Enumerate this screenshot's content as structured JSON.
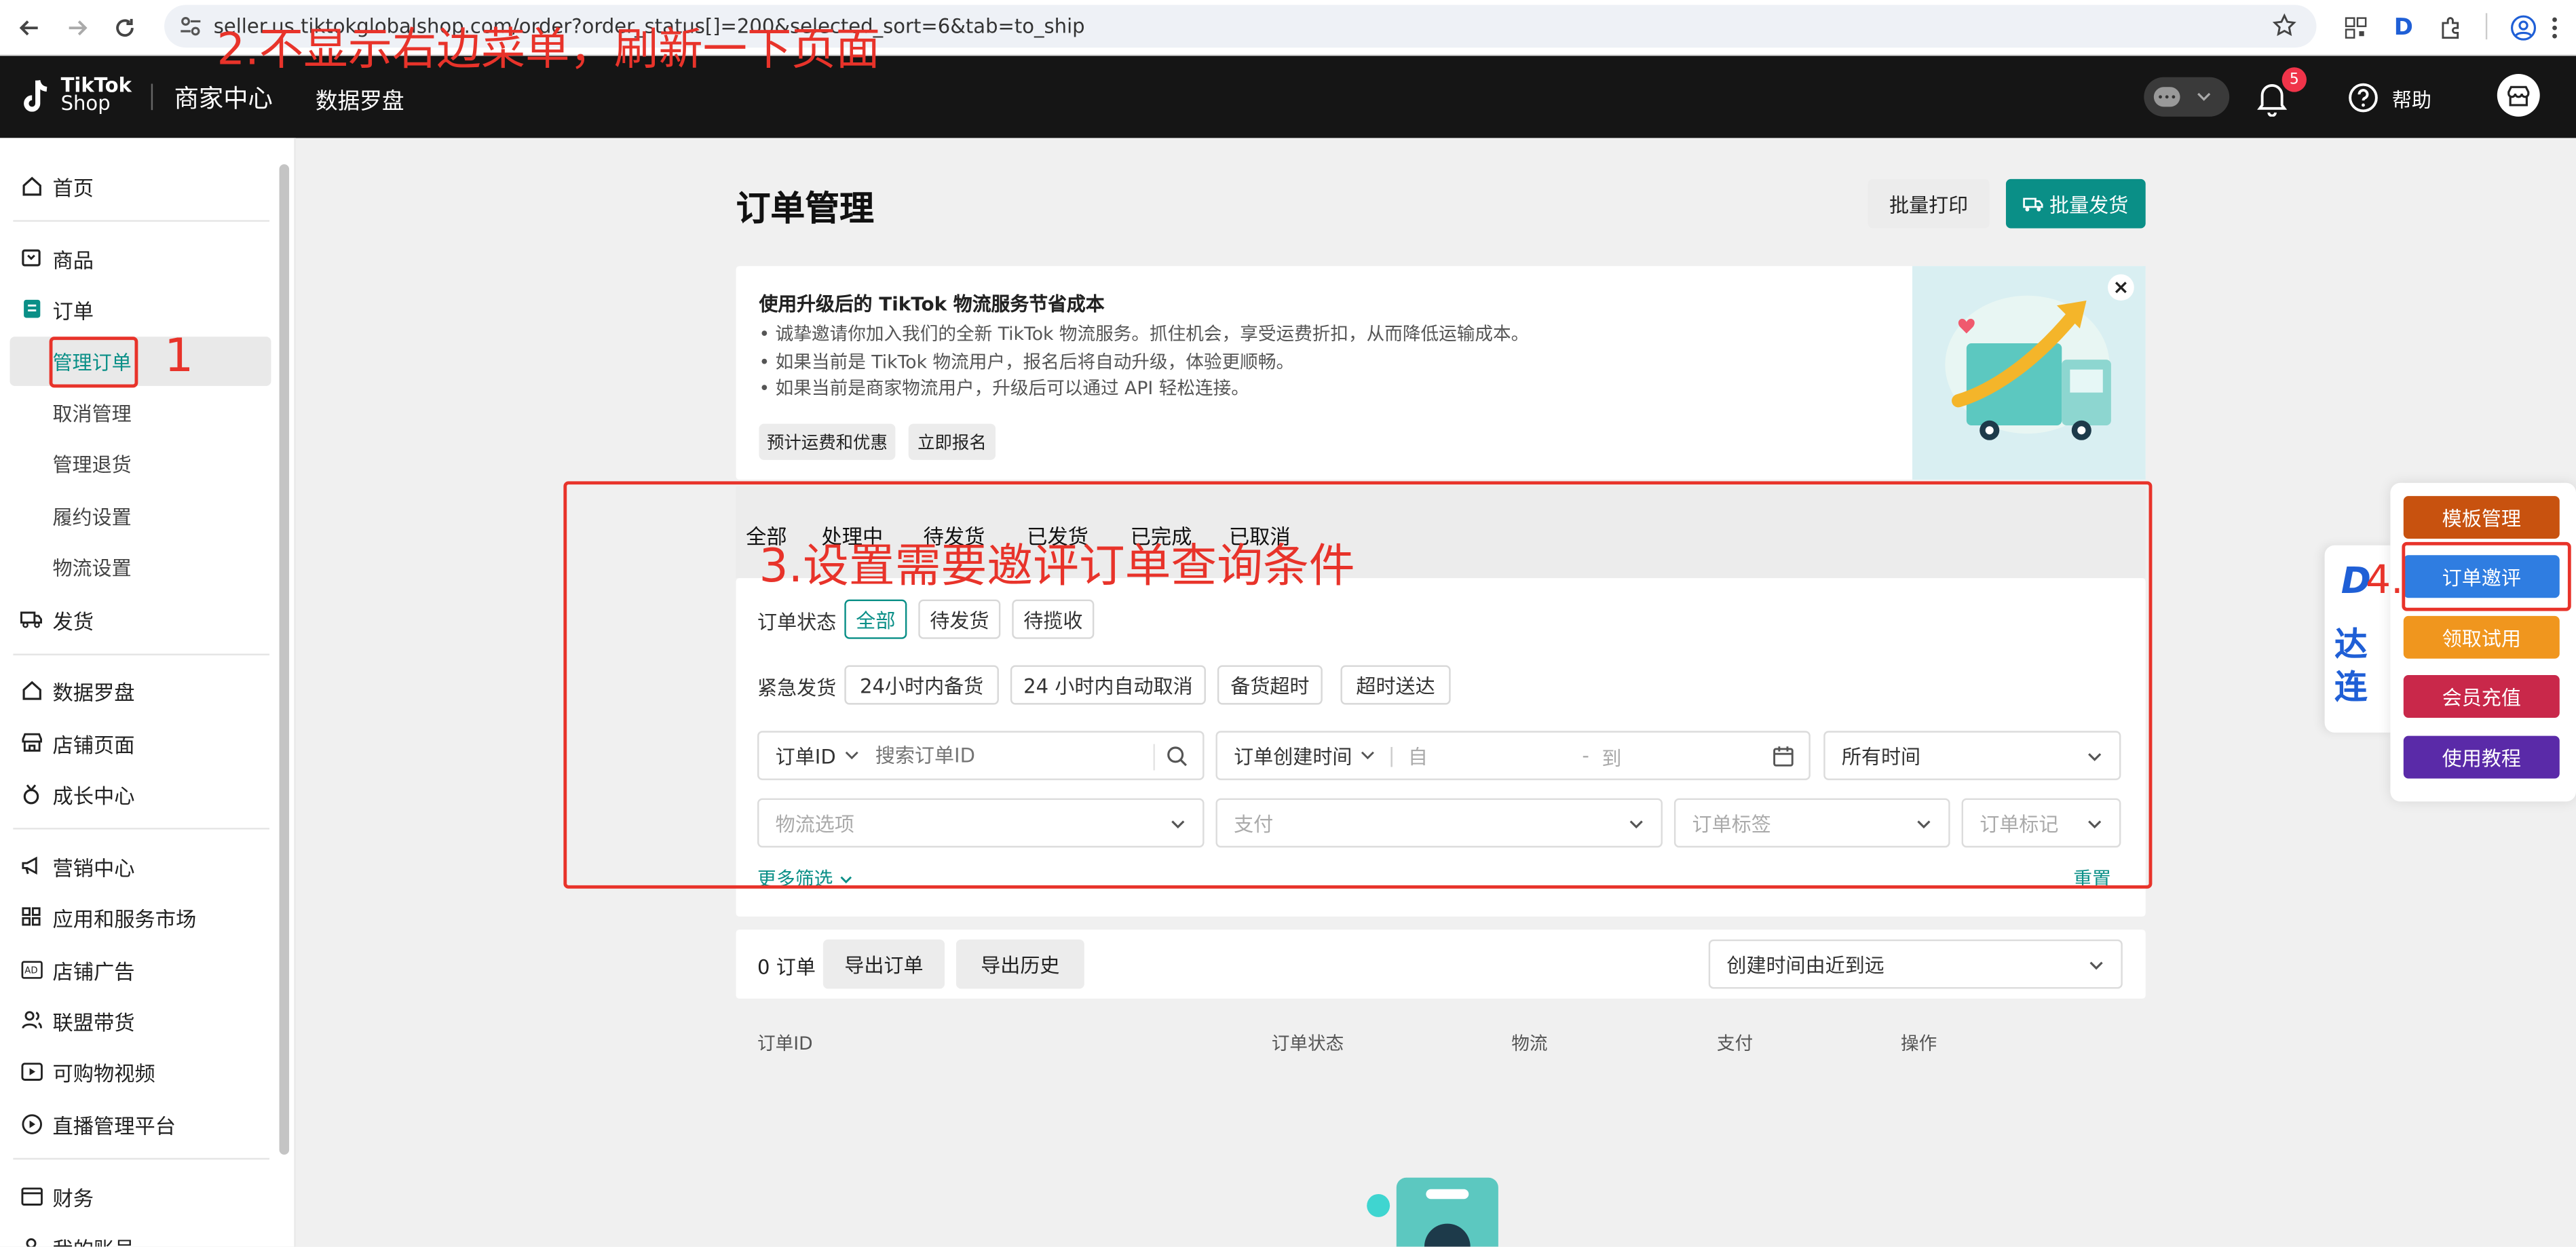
{
  "browser": {
    "url": "seller.us.tiktokglobalshop.com/order?order_status[]=200&selected_sort=6&tab=to_ship"
  },
  "header": {
    "logo_line1": "TikTok",
    "logo_line2": "Shop",
    "merchant_center": "商家中心",
    "data_compass": "数据罗盘",
    "notification_count": "5",
    "help": "帮助"
  },
  "sidebar": {
    "home": "首页",
    "products": "商品",
    "orders": "订单",
    "manage_orders": "管理订单",
    "cancel_manage": "取消管理",
    "manage_returns": "管理退货",
    "fulfillment_settings": "履约设置",
    "logistics_settings": "物流设置",
    "shipping": "发货",
    "data_compass": "数据罗盘",
    "shop_page": "店铺页面",
    "growth_center": "成长中心",
    "marketing_center": "营销中心",
    "apps_market": "应用和服务市场",
    "shop_ads": "店铺广告",
    "affiliate": "联盟带货",
    "shoppable_video": "可购物视频",
    "live_platform": "直播管理平台",
    "finance": "财务",
    "my_account": "我的账号"
  },
  "page": {
    "title": "订单管理",
    "batch_print": "批量打印",
    "batch_ship": "批量发货"
  },
  "banner": {
    "title": "使用升级后的 TikTok 物流服务节省成本",
    "bullets": [
      "诚挚邀请你加入我们的全新 TikTok 物流服务。抓住机会，享受运费折扣，从而降低运输成本。",
      "如果当前是 TikTok 物流用户，报名后将自动升级，体验更顺畅。",
      "如果当前是商家物流用户，升级后可以通过 API 轻松连接。"
    ],
    "btn_estimate": "预计运费和优惠",
    "btn_signup": "立即报名"
  },
  "tabs": [
    "全部",
    "处理中",
    "待发货",
    "已发货",
    "已完成",
    "已取消"
  ],
  "filters": {
    "order_status_label": "订单状态",
    "status_options": [
      "全部",
      "待发货",
      "待揽收"
    ],
    "urgent_label": "紧急发货",
    "urgent_options": [
      "24小时内备货",
      "24 小时内自动取消",
      "备货超时",
      "超时送达"
    ],
    "order_id_select": "订单ID",
    "search_placeholder": "搜索订单ID",
    "created_time_select": "订单创建时间",
    "date_from": "自",
    "date_dash": "-",
    "date_to": "到",
    "all_time": "所有时间",
    "logistics_placeholder": "物流选项",
    "payment_placeholder": "支付",
    "order_tag_placeholder": "订单标签",
    "order_mark_placeholder": "订单标记",
    "more_filters": "更多筛选",
    "reset": "重置"
  },
  "results": {
    "count": "0 订单",
    "export_orders": "导出订单",
    "export_history": "导出历史",
    "sort": "创建时间由近到远",
    "columns": [
      "订单ID",
      "订单状态",
      "物流",
      "支付",
      "操作"
    ]
  },
  "plugin": {
    "logo_letter": "D",
    "logo_text1": "达",
    "logo_text2": "连",
    "buttons": [
      {
        "label": "模板管理",
        "color": "#c8520f"
      },
      {
        "label": "订单邀评",
        "color": "#2f7de1"
      },
      {
        "label": "领取试用",
        "color": "#f0961e"
      },
      {
        "label": "会员充值",
        "color": "#c9284a"
      },
      {
        "label": "使用教程",
        "color": "#5a2aa8"
      }
    ]
  },
  "annotations": {
    "step1": "1",
    "step2": "2.不显示右边菜单，刷新一下页面",
    "step3": "3.设置需要邀评订单查询条件",
    "step4": "4."
  },
  "colors": {
    "brand_teal": "#0a8f87",
    "annotation_red": "#e8332a",
    "header_bg": "#151515"
  }
}
